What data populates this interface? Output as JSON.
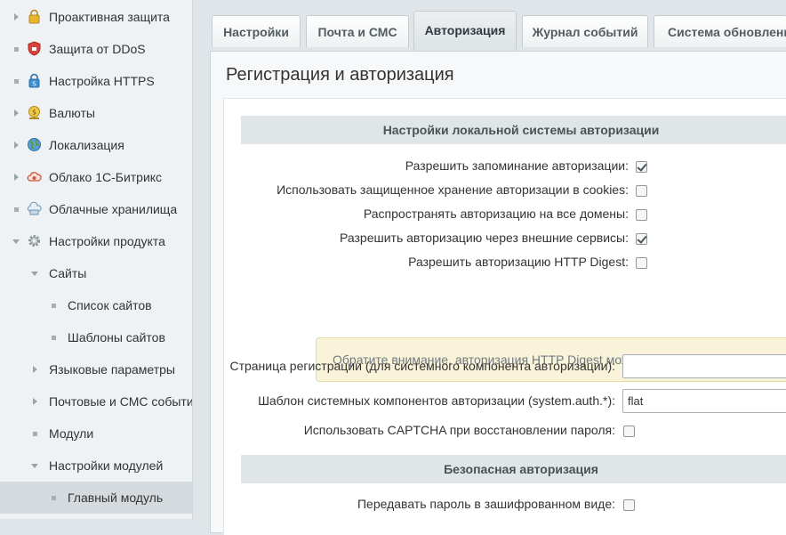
{
  "sidebar": {
    "items": [
      {
        "label": "Проактивная защита",
        "icon": "lock-icon"
      },
      {
        "label": "Защита от DDoS",
        "icon": "shield-icon"
      },
      {
        "label": "Настройка HTTPS",
        "icon": "https-lock-icon"
      },
      {
        "label": "Валюты",
        "icon": "coin-icon"
      },
      {
        "label": "Локализация",
        "icon": "globe-icon"
      },
      {
        "label": "Облако 1С-Битрикс",
        "icon": "cloud-icon"
      },
      {
        "label": "Облачные хранилища",
        "icon": "storage-icon"
      },
      {
        "label": "Настройки продукта",
        "icon": "gear-icon"
      },
      {
        "label": "Сайты"
      },
      {
        "label": "Список сайтов"
      },
      {
        "label": "Шаблоны сайтов"
      },
      {
        "label": "Языковые параметры"
      },
      {
        "label": "Почтовые и СМС события"
      },
      {
        "label": "Модули"
      },
      {
        "label": "Настройки модулей"
      },
      {
        "label": "Главный модуль"
      }
    ]
  },
  "tabs": [
    {
      "label": "Настройки"
    },
    {
      "label": "Почта и СМС"
    },
    {
      "label": "Авторизация",
      "active": true
    },
    {
      "label": "Журнал событий"
    },
    {
      "label": "Система обновлений"
    }
  ],
  "page": {
    "title": "Регистрация и авторизация"
  },
  "local_auth": {
    "heading": "Настройки локальной системы авторизации",
    "options": [
      {
        "label": "Разрешить запоминание авторизации:",
        "checked": true
      },
      {
        "label": "Использовать защищенное хранение авторизации в cookies:",
        "checked": false
      },
      {
        "label": "Распространять авторизацию на все домены:",
        "checked": false
      },
      {
        "label": "Разрешить авторизацию через внешние сервисы:",
        "checked": true
      },
      {
        "label": "Разрешить авторизацию HTTP Digest:",
        "checked": false
      }
    ],
    "notice": "Обратите внимание, авторизация HTTP Digest может применяться только для встроенной",
    "registration_page": {
      "label": "Страница регистрации (для системного компонента авторизации):",
      "value": ""
    },
    "auth_template": {
      "label": "Шаблон системных компонентов авторизации (system.auth.*):",
      "value": "flat"
    },
    "captcha": {
      "label": "Использовать CAPTCHA при восстановлении пароля:",
      "checked": false
    }
  },
  "secure_auth": {
    "heading": "Безопасная авторизация",
    "encrypt_password": {
      "label": "Передавать пароль в зашифрованном виде:",
      "checked": false
    }
  }
}
